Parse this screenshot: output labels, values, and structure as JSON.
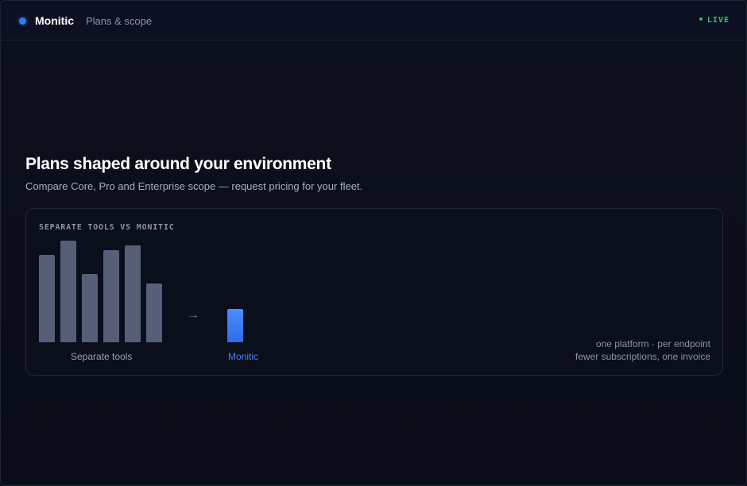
{
  "app": {
    "brand": "Monitic",
    "breadcrumb": "Plans & scope",
    "status": "LIVE",
    "accent_color": "#2f7df6",
    "status_color": "#27c36d"
  },
  "hero": {
    "title": "Plans shaped around your environment",
    "subtitle": "Compare Core, Pro and Enterprise scope — request pricing for your fleet."
  },
  "comparison": {
    "label": "SEPARATE TOOLS VS MONITIC",
    "arrow": "→",
    "separate_label": "Separate tools",
    "monitic_label": "Monitic",
    "note_line1": "one platform · per endpoint",
    "note_line2": "fewer subscriptions, one invoice"
  },
  "chart_data": {
    "type": "bar",
    "categories": [
      "",
      "",
      "",
      "",
      "",
      "",
      "Monitic"
    ],
    "groups": [
      "Separate tools",
      "Separate tools",
      "Separate tools",
      "Separate tools",
      "Separate tools",
      "Separate tools",
      "Monitic"
    ],
    "values": [
      110,
      128,
      86,
      116,
      122,
      74,
      42
    ],
    "ylim": [
      0,
      130
    ],
    "grid": false,
    "colors": [
      "#575f78",
      "#575f78",
      "#575f78",
      "#575f78",
      "#575f78",
      "#575f78",
      "#3f86ff"
    ]
  }
}
